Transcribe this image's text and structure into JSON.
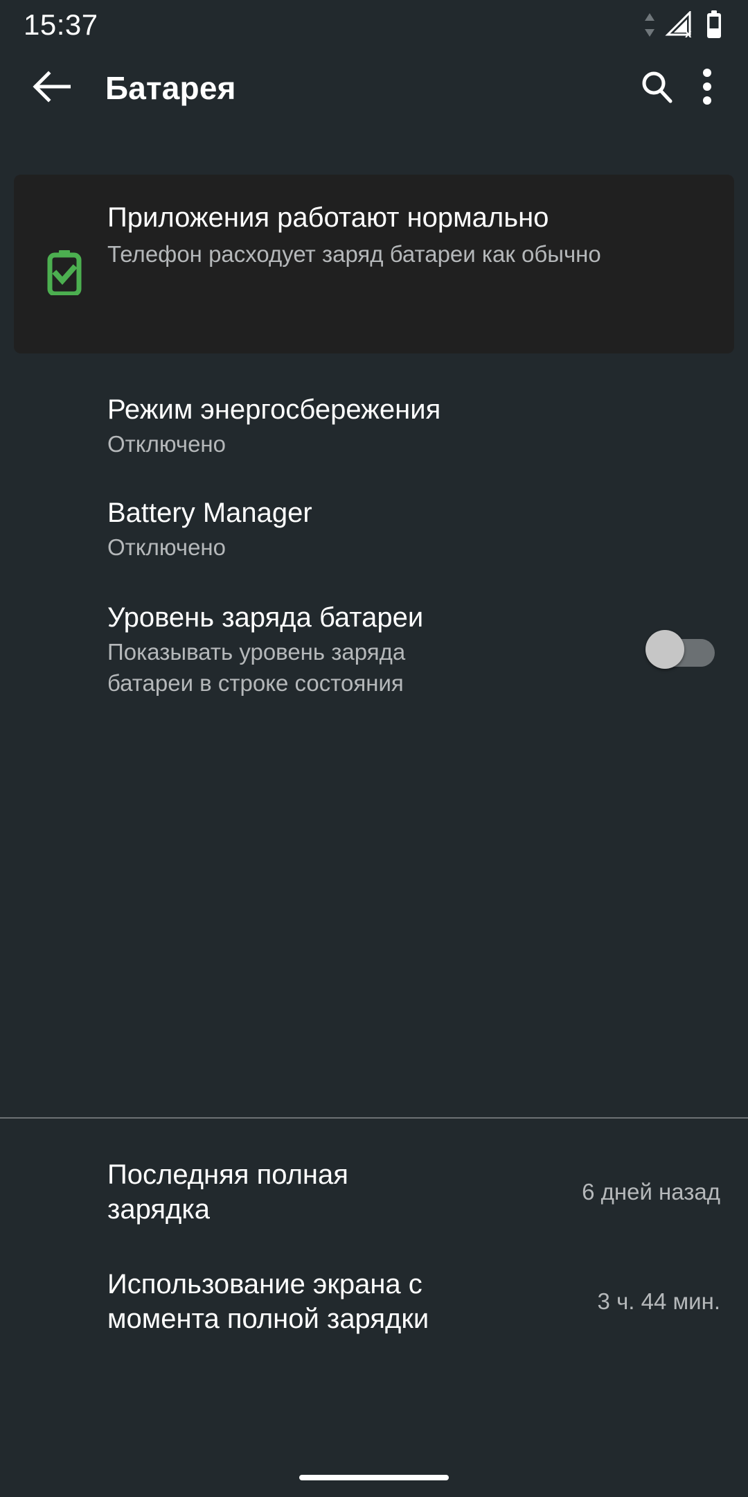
{
  "status_bar": {
    "time": "15:37",
    "icons": [
      "data-transfer-arrows-icon",
      "signal-no-service-icon",
      "battery-icon"
    ]
  },
  "app_bar": {
    "back_label": "back-arrow-icon",
    "title": "Батарея",
    "search_label": "search-icon",
    "overflow_label": "more-options-icon"
  },
  "tip_card": {
    "icon": "battery-check-icon",
    "icon_color": "#4caf50",
    "title": "Приложения работают нормально",
    "subtitle": "Телефон расходует заряд батареи как обычно"
  },
  "settings": [
    {
      "title": "Режим энергосбережения",
      "subtitle": "Отключено"
    },
    {
      "title": "Battery Manager",
      "subtitle": "Отключено"
    },
    {
      "title": "Уровень заряда батареи",
      "subtitle": "Показывать уровень заряда батареи в строке состояния",
      "toggle_state": "off"
    }
  ],
  "stats": [
    {
      "title": "Последняя полная зарядка",
      "value": "6 дней назад"
    },
    {
      "title": "Использование экрана с момента полной зарядки",
      "value": "3 ч. 44 мин."
    }
  ],
  "nav": {
    "gesture_pill": "home-gesture-pill"
  }
}
